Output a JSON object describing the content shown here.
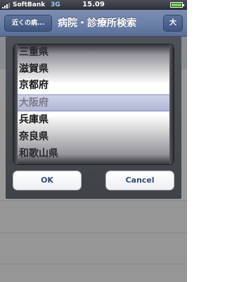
{
  "status_bar": {
    "carrier": "SoftBank",
    "network": "3G",
    "time": "15.09"
  },
  "nav": {
    "back_label": "近くの病...",
    "title": "病院・診療所検索",
    "right_label": "大"
  },
  "picker": {
    "items": [
      "三重県",
      "滋賀県",
      "京都府",
      "大阪府",
      "兵庫県",
      "奈良県",
      "和歌山県"
    ],
    "selected": "大阪府"
  },
  "buttons": {
    "ok": "OK",
    "cancel": "Cancel"
  },
  "colors": {
    "nav_bar": "#6d82a8",
    "dialog": "#45494e",
    "button_text": "#334a78"
  }
}
